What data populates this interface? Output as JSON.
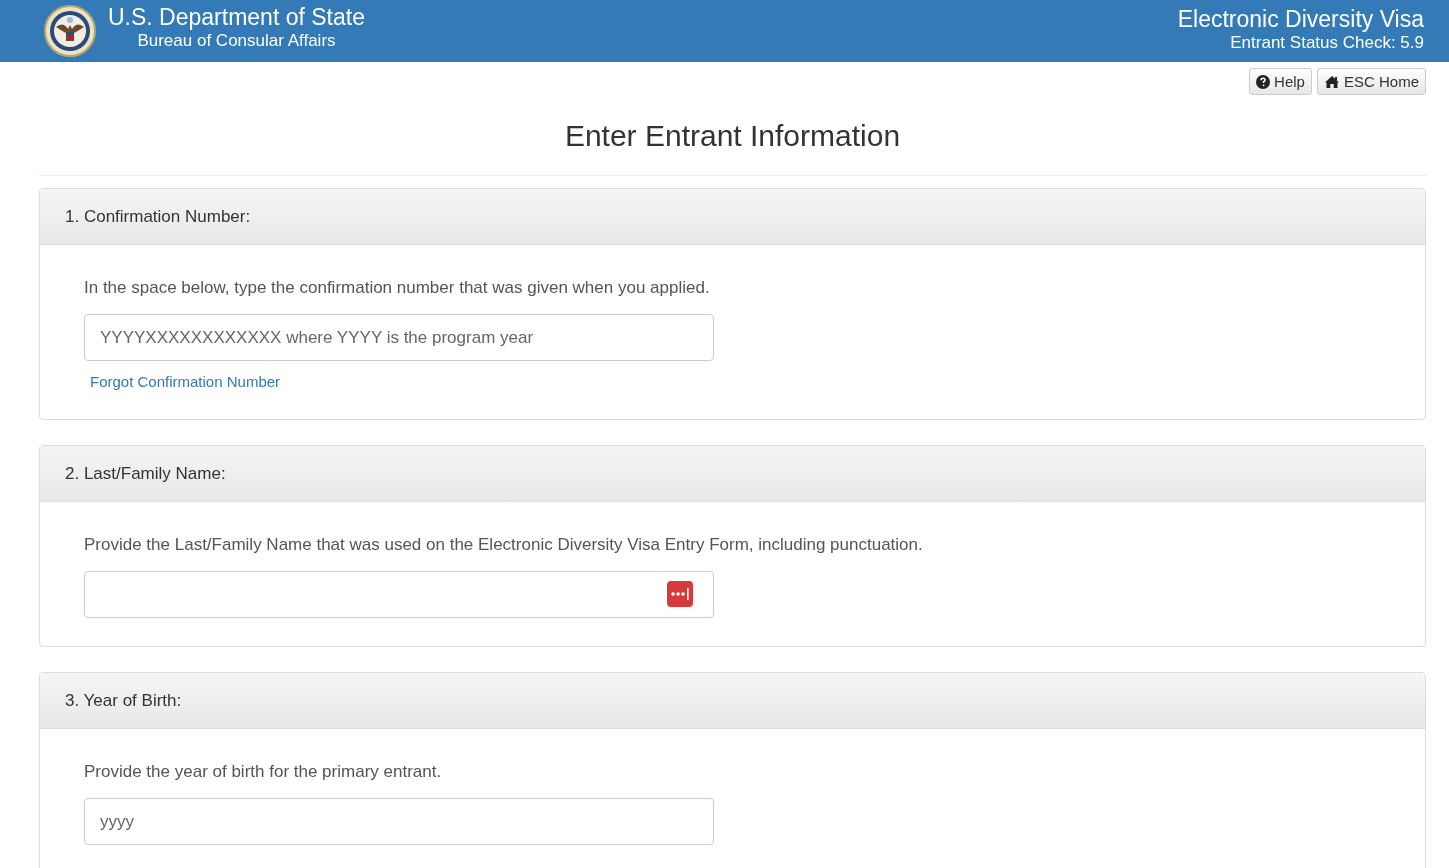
{
  "header": {
    "agency": "U.S. Department of State",
    "bureau": "Bureau of Consular Affairs",
    "program": "Electronic Diversity Visa",
    "subtitle": "Entrant Status Check: 5.9"
  },
  "nav_buttons": [
    {
      "kind": "help",
      "label": "Help"
    },
    {
      "kind": "home",
      "label": "ESC Home"
    }
  ],
  "page_title": "Enter Entrant Information",
  "sections": [
    {
      "heading": "1. Confirmation Number:",
      "instruction": "In the space below, type the confirmation number that was given when you applied.",
      "placeholder": "YYYYXXXXXXXXXXXX where YYYY is the program year",
      "link": "Forgot Confirmation Number",
      "password_manager_icon": false
    },
    {
      "heading": "2. Last/Family Name:",
      "instruction": "Provide the Last/Family Name that was used on the Electronic Diversity Visa Entry Form, including punctuation.",
      "password_manager_icon": true
    },
    {
      "heading": "3. Year of Birth:",
      "instruction": "Provide the year of birth for the primary entrant.",
      "placeholder": "yyyy",
      "password_manager_icon": false
    }
  ]
}
